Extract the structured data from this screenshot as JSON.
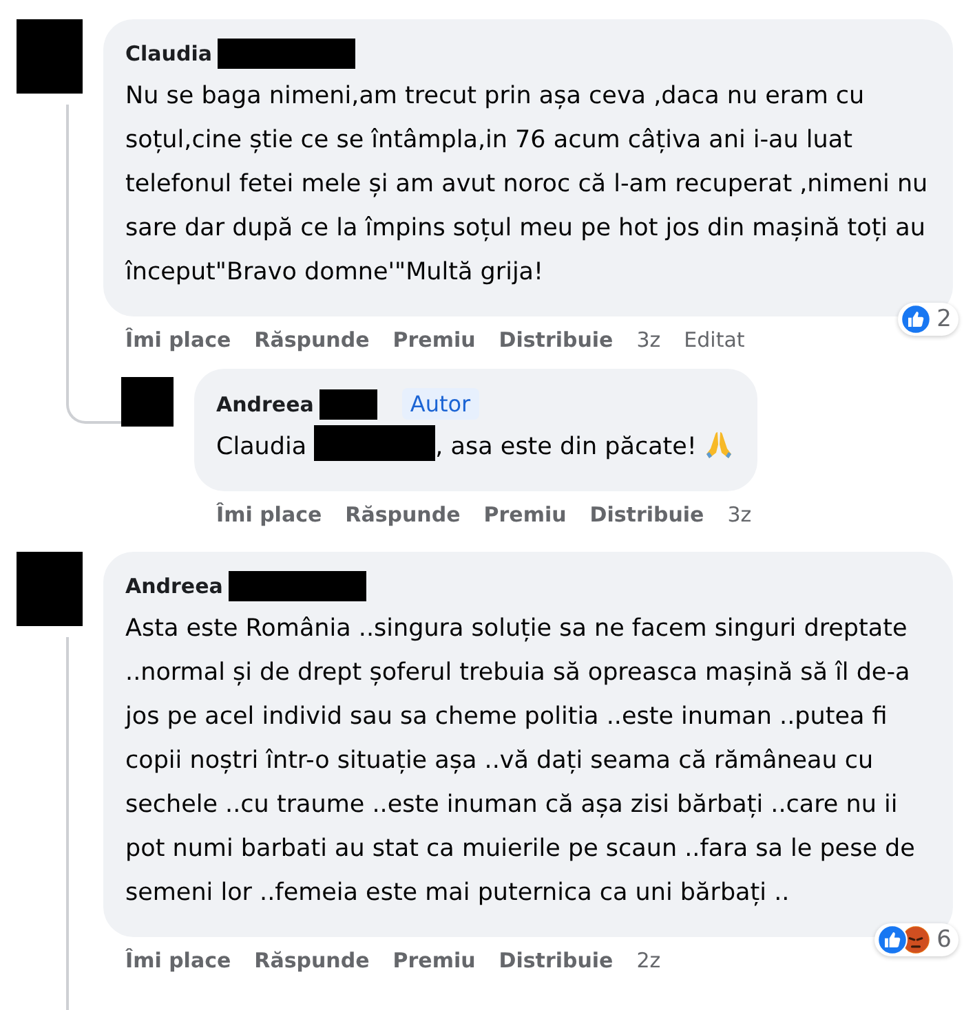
{
  "comments": [
    {
      "author": "Claudia",
      "text": "Nu se baga nimeni,am trecut prin așa ceva ,daca nu eram cu soțul,cine știe ce se întâmpla,in 76 acum câțiva ani i-au luat telefonul fetei mele și am avut noroc că l-am recuperat ,nimeni nu sare dar după ce la împins soțul meu pe hot jos din mașină toți au început\"Bravo domne'\"Multă grija!",
      "actions": [
        "Îmi place",
        "Răspunde",
        "Premiu",
        "Distribuie"
      ],
      "time": "3z",
      "edited": "Editat",
      "reactions": [
        {
          "kind": "like"
        }
      ],
      "reaction_count": "2",
      "replies": [
        {
          "author": "Andreea",
          "author_badge": "Autor",
          "text_prefix": "Claudia",
          "text": ", asa este din păcate!",
          "emoji": {
            "kind": "pray"
          },
          "actions": [
            "Îmi place",
            "Răspunde",
            "Premiu",
            "Distribuie"
          ],
          "time": "3z"
        }
      ]
    },
    {
      "author": "Andreea",
      "text": "Asta este România ..singura soluție sa ne facem singuri dreptate ..normal și de drept șoferul trebuia să opreasca mașină să îl de-a jos pe acel individ sau sa cheme politia ..este inuman ..putea fi copii noștri într-o situație așa ..vă dați seama că rămâneau cu sechele ..cu traume ..este inuman că așa zisi bărbați ..care nu ii pot numi barbati au stat ca muierile pe scaun ..fara sa le pese de semeni lor ..femeia este mai puternica ca uni bărbați ..",
      "actions": [
        "Îmi place",
        "Răspunde",
        "Premiu",
        "Distribuie"
      ],
      "time": "2z",
      "reactions": [
        {
          "kind": "like"
        },
        {
          "kind": "angry"
        }
      ],
      "reaction_count": "6"
    }
  ]
}
